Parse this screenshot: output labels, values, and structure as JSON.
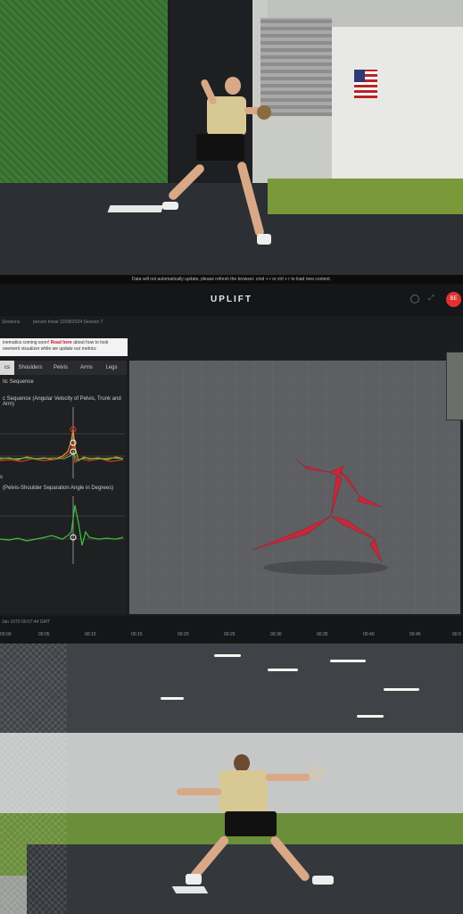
{
  "notice": {
    "text": "Data will not automatically update, please refresh the browser.  cmd + r or  ctrl + r to load new content."
  },
  "header": {
    "brand": "UPLIFT",
    "avatar_initials": "BE"
  },
  "breadcrumb": {
    "sessions": "Sessions",
    "session": "person hewe 10/08/2024 Session 7"
  },
  "banner": {
    "line1_prefix": "inematics coming soon! ",
    "link": "Read here",
    "line1_suffix": " about how to look",
    "line2": "ovement visualizer while we update our metrics"
  },
  "tabs": [
    {
      "label": "cs",
      "active": true
    },
    {
      "label": "Shoulders",
      "active": false
    },
    {
      "label": "Pelvis",
      "active": false
    },
    {
      "label": "Arms",
      "active": false
    },
    {
      "label": "Legs",
      "active": false
    }
  ],
  "panel": {
    "section_label": "tic Sequence",
    "chart1_title": "c Sequence (Angular Velocity of Pelvis, Trunk and Arm)",
    "chart2_marker": "s",
    "chart2_title": "(Pelvis-Shoulder Separation Angle in Degrees)"
  },
  "timeline": {
    "timestamp": "Jan 1970 00:07:44 GMT",
    "ticks": [
      "00:00",
      "00:05",
      "00:10",
      "00:15",
      "00:20",
      "00:25",
      "00:30",
      "00:35",
      "00:40",
      "00:45",
      "00:5"
    ]
  },
  "colors": {
    "accent_red": "#e03232",
    "skeleton_red": "#c8283a",
    "trace_green": "#3cc43c",
    "trace_orange": "#e0962a",
    "trace_red": "#d43a2a"
  }
}
